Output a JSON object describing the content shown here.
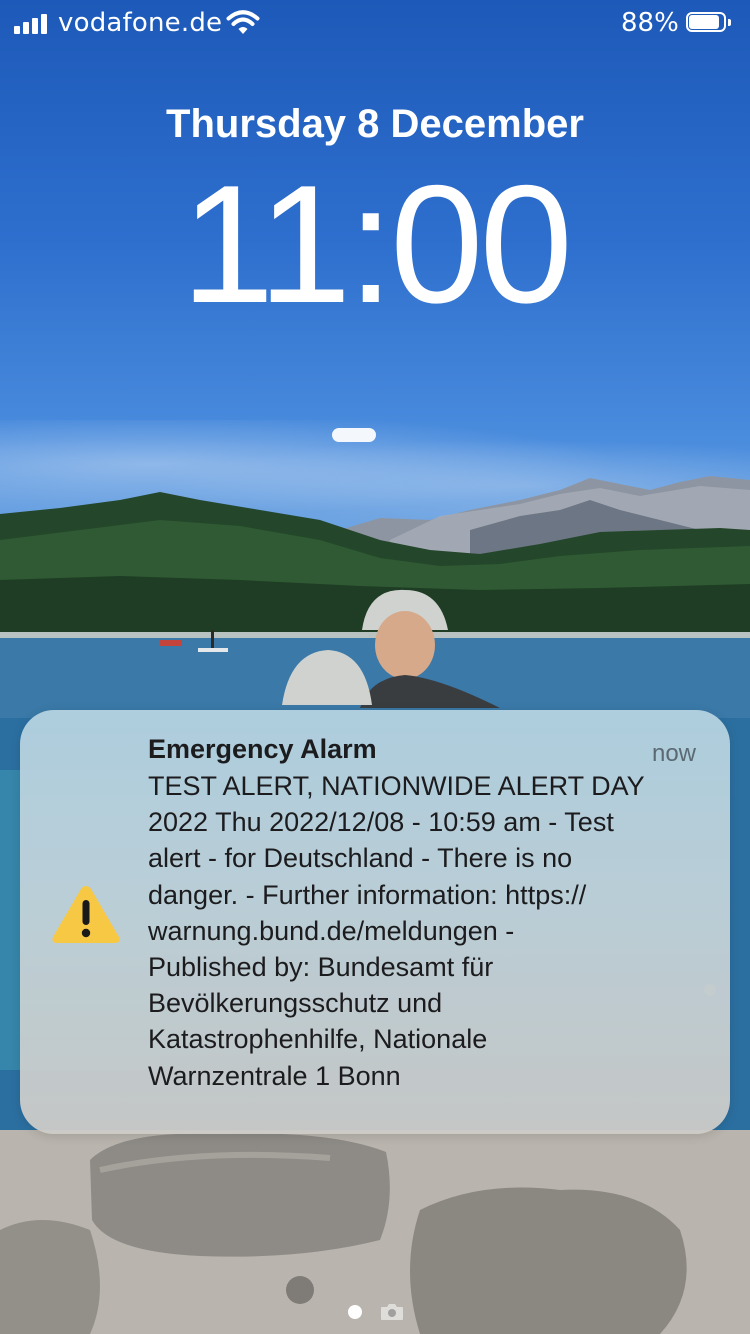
{
  "status_bar": {
    "carrier": "vodafone.de",
    "battery_percent": "88%",
    "battery_level": 0.88,
    "signal_bars": 4,
    "icons": [
      "signal-bars-icon",
      "wifi-icon",
      "battery-icon"
    ]
  },
  "lock_screen": {
    "date": "Thursday 8 December",
    "time": "11:00"
  },
  "notification": {
    "app": "Emergency Alarm",
    "time": "now",
    "icon": "warning-triangle-icon",
    "icon_color": "#F7C843",
    "body": "TEST ALERT, NATIONWIDE ALERT DAY\n2022 Thu 2022/12/08 - 10:59 am - Test\nalert - for Deutschland - There is no\ndanger. - Further information: https://\nwarnung.bund.de/meldungen -\nPublished by: Bundesamt für\nBevölkerungsschutz und\nKatastrophenhilfe, Nationale\nWarnzentrale 1 Bonn"
  },
  "page_indicator": {
    "icons": [
      "page-dot-icon",
      "camera-icon"
    ]
  }
}
